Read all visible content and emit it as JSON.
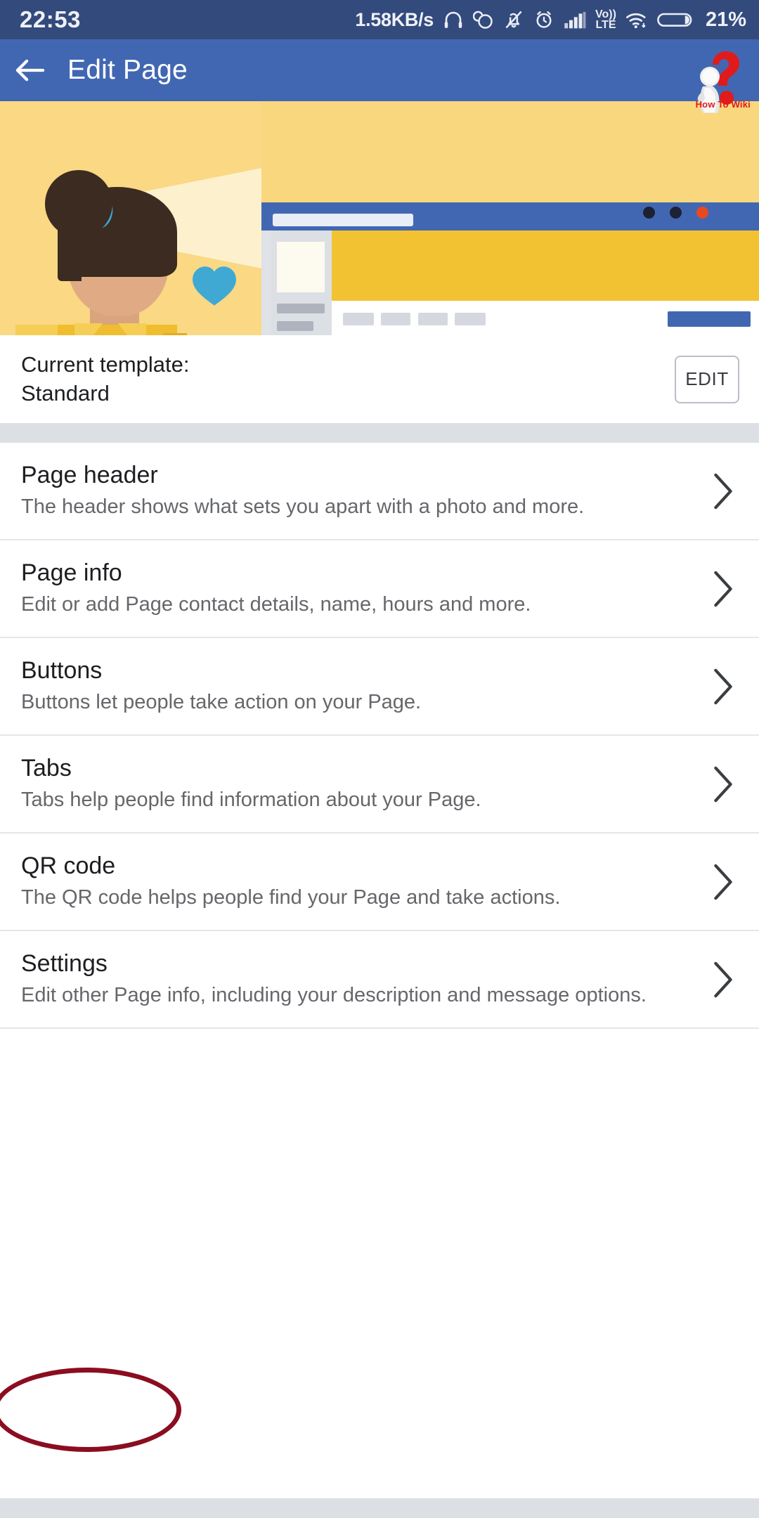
{
  "statusbar": {
    "clock": "22:53",
    "network_speed": "1.58KB/s",
    "battery_percent": "21%",
    "icons": [
      "headphones-icon",
      "data-sync-icon",
      "bell-off-icon",
      "alarm-icon",
      "signal-bars-icon",
      "volte-icon",
      "wifi-icon",
      "battery-icon"
    ],
    "volte_label_top": "Vo))",
    "volte_label_bottom": "LTE"
  },
  "appbar": {
    "back_icon": "back-arrow-icon",
    "title": "Edit Page",
    "background": "#4267b2"
  },
  "watermark": {
    "text": "How To Wiki",
    "color": "#e01b1b",
    "icons": [
      "question-mark-icon",
      "thinking-person-icon"
    ]
  },
  "hero": {
    "illustration": "woman-with-yellow-jacket-illustration",
    "heart_icon": "heart-icon",
    "heart_color": "#3fa9d3",
    "background": "#fad884",
    "beam_color": "#fdf0cd"
  },
  "mockup": {
    "name": "page-template-preview",
    "cover_color": "#f2c232",
    "cta_color": "#4267b2",
    "pager": {
      "dots": 3,
      "active_index": 2,
      "inactive_color": "#1b2233",
      "active_color": "#e8491f"
    }
  },
  "template_section": {
    "label": "Current template:",
    "value": "Standard",
    "edit_label": "EDIT"
  },
  "list": {
    "items": [
      {
        "title": "Page header",
        "desc": "The header shows what sets you apart with a photo and more.",
        "chevron": "chevron-right-icon"
      },
      {
        "title": "Page info",
        "desc": "Edit or add Page contact details, name, hours and more.",
        "chevron": "chevron-right-icon"
      },
      {
        "title": "Buttons",
        "desc": "Buttons let people take action on your Page.",
        "chevron": "chevron-right-icon"
      },
      {
        "title": "Tabs",
        "desc": "Tabs help people find information about your Page.",
        "chevron": "chevron-right-icon"
      },
      {
        "title": "QR code",
        "desc": "The QR code helps people find your Page and take actions.",
        "chevron": "chevron-right-icon"
      },
      {
        "title": "Settings",
        "desc": "Edit other Page info, including your description and message options.",
        "chevron": "chevron-right-icon"
      }
    ]
  },
  "annotation": {
    "shape": "ellipse",
    "color": "#8b0d20",
    "targets": "Settings"
  }
}
